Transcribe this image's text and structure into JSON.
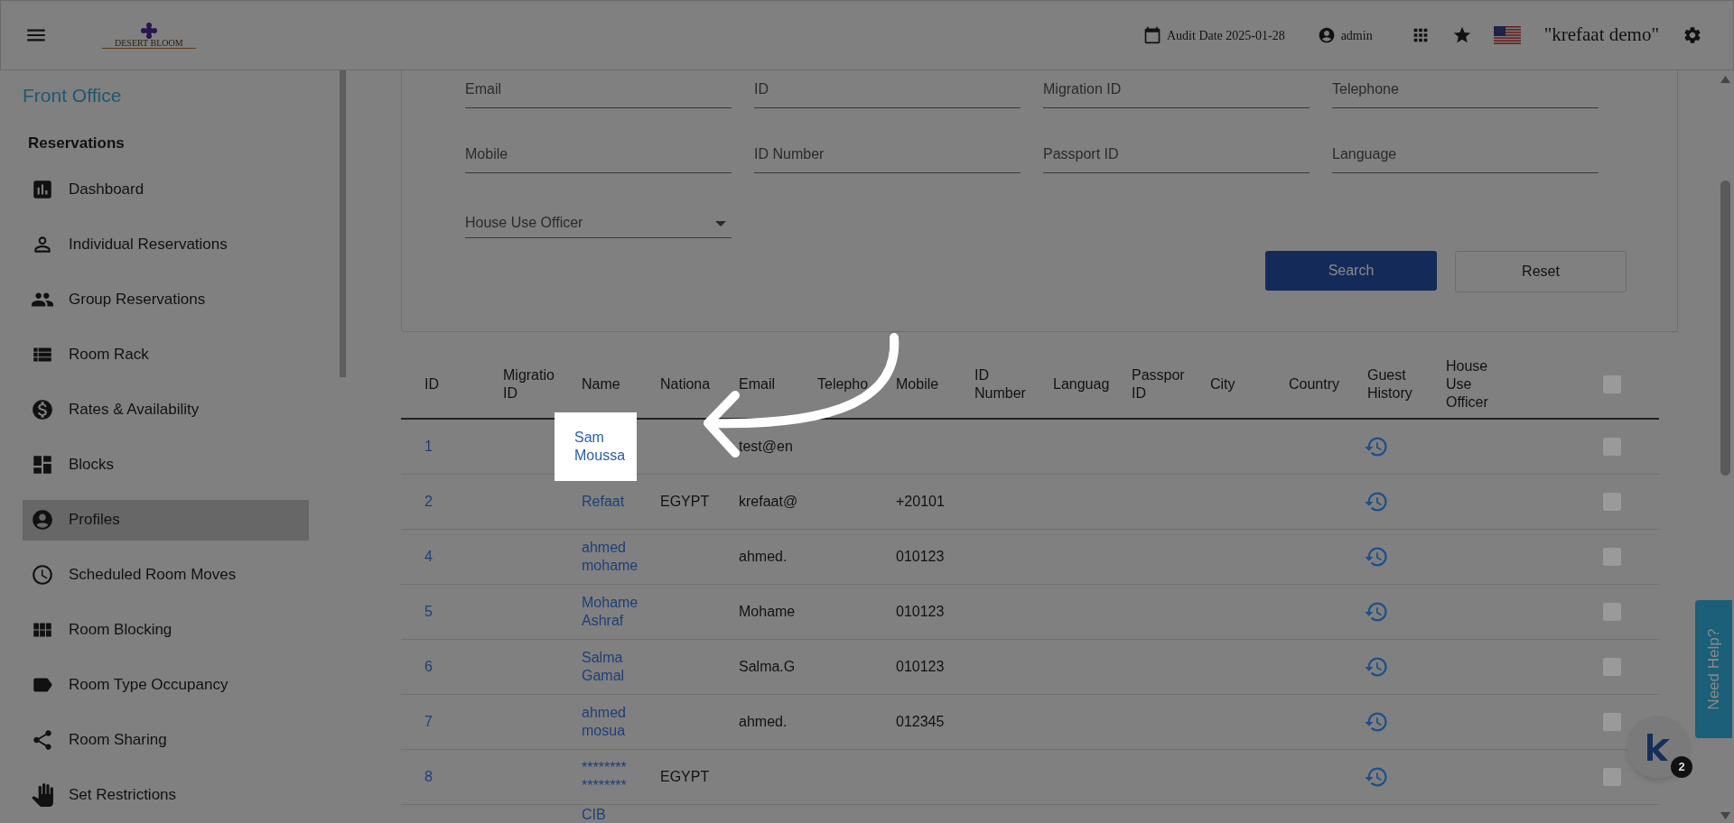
{
  "header": {
    "logo": "DESERT BLOOM",
    "audit_date": "Audit Date 2025-01-28",
    "user": "admin",
    "property": "\"krefaat demo\""
  },
  "sidebar": {
    "title": "Front Office",
    "section": "Reservations",
    "items": [
      {
        "label": "Dashboard",
        "selected": false
      },
      {
        "label": "Individual Reservations",
        "selected": false
      },
      {
        "label": "Group Reservations",
        "selected": false
      },
      {
        "label": "Room Rack",
        "selected": false
      },
      {
        "label": "Rates & Availability",
        "selected": false
      },
      {
        "label": "Blocks",
        "selected": false
      },
      {
        "label": "Profiles",
        "selected": true
      },
      {
        "label": "Scheduled Room Moves",
        "selected": false
      },
      {
        "label": "Room Blocking",
        "selected": false
      },
      {
        "label": "Room Type Occupancy",
        "selected": false
      },
      {
        "label": "Room Sharing",
        "selected": false
      },
      {
        "label": "Set Restrictions",
        "selected": false
      }
    ]
  },
  "search_form": {
    "fields": [
      {
        "placeholder": "Email",
        "kind": "text"
      },
      {
        "placeholder": "ID",
        "kind": "text"
      },
      {
        "placeholder": "Migration ID",
        "kind": "text"
      },
      {
        "placeholder": "Telephone",
        "kind": "text"
      },
      {
        "placeholder": "Mobile",
        "kind": "text"
      },
      {
        "placeholder": "ID Number",
        "kind": "text"
      },
      {
        "placeholder": "Passport ID",
        "kind": "text"
      },
      {
        "placeholder": "Language",
        "kind": "text"
      },
      {
        "placeholder": "House Use Officer",
        "kind": "select"
      }
    ],
    "buttons": [
      {
        "label": "Search",
        "kind": "primary"
      },
      {
        "label": "Reset",
        "kind": "secondary"
      }
    ]
  },
  "table": {
    "columns": [
      "ID",
      "Migratio\nID",
      "Name",
      "Nationa",
      "Email",
      "Telepho",
      "Mobile",
      "ID\nNumber",
      "Languag",
      "Passpor\nID",
      "City",
      "Country",
      "Guest\nHistory",
      "House\nUse\nOfficer"
    ],
    "header_checked": false,
    "rows": [
      {
        "id": "1",
        "name": "Sam\nMoussa",
        "email": "test@en",
        "highlighted": true,
        "checked": false
      },
      {
        "id": "2",
        "name": "Refaat",
        "nationality": "EGYPT",
        "email": "krefaat@",
        "mobile": "+20101",
        "highlighted": false,
        "checked": false
      },
      {
        "id": "4",
        "name": "ahmed\nmohame",
        "email": "ahmed.",
        "mobile": "010123",
        "highlighted": false,
        "checked": false
      },
      {
        "id": "5",
        "name": "Mohame\nAshraf",
        "email": "Mohame",
        "mobile": "010123",
        "highlighted": false,
        "checked": false
      },
      {
        "id": "6",
        "name": "Salma\nGamal",
        "email": "Salma.G",
        "mobile": "010123",
        "highlighted": false,
        "checked": false
      },
      {
        "id": "7",
        "name": "ahmed\nmosua",
        "email": "ahmed.",
        "mobile": "012345",
        "highlighted": false,
        "checked": false
      },
      {
        "id": "8",
        "name": "********\n********",
        "nationality": "EGYPT",
        "highlighted": false,
        "checked": false
      },
      {
        "name": "CIB",
        "highlighted": false,
        "partial": true
      }
    ]
  },
  "help": {
    "label": "Need Help?"
  },
  "chat": {
    "badge": "2"
  }
}
